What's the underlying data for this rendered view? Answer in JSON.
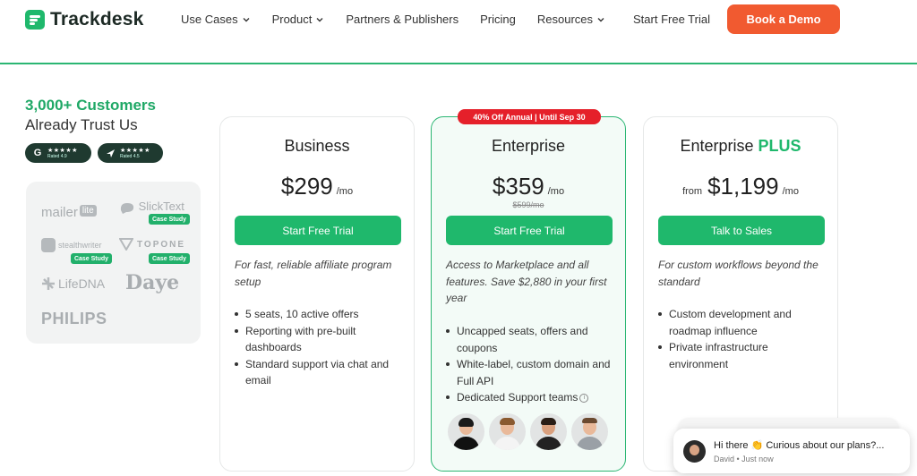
{
  "nav": {
    "logo_text": "Trackdesk",
    "links": [
      {
        "label": "Use Cases",
        "dropdown": true
      },
      {
        "label": "Product",
        "dropdown": true
      },
      {
        "label": "Partners & Publishers",
        "dropdown": false
      },
      {
        "label": "Pricing",
        "dropdown": false
      },
      {
        "label": "Resources",
        "dropdown": true
      }
    ],
    "trial_label": "Start Free Trial",
    "demo_label": "Book a Demo"
  },
  "trust": {
    "line1": "3,000+ Customers",
    "line2": "Already Trust Us",
    "badges": [
      {
        "icon": "g2-icon",
        "stars": "★★★★★",
        "rating": "Rated 4.9"
      },
      {
        "icon": "capterra-icon",
        "stars": "★★★★★",
        "rating": "Rated 4.5"
      }
    ]
  },
  "logos": {
    "mailerlite": "mailer",
    "mailerlite_tag": "lite",
    "slicktext": "SlickText",
    "stealthwriter": "stealthwriter",
    "topone": "TOPONE",
    "lifedna": "LifeDNA",
    "daye": "Daye",
    "philips": "PHILIPS",
    "case_study_label": "Case Study"
  },
  "promo": "40% Off Annual | Until Sep 30",
  "plans": [
    {
      "title": "Business",
      "title_suffix": "",
      "price_prefix": "",
      "price": "$299",
      "per": "/mo",
      "old_price": "",
      "cta": "Start Free Trial",
      "description": "For fast, reliable affiliate program setup",
      "features": [
        "5 seats, 10 active offers",
        "Reporting with pre-built dashboards",
        "Standard support via chat and email"
      ]
    },
    {
      "title": "Enterprise",
      "title_suffix": "",
      "price_prefix": "",
      "price": "$359",
      "per": "/mo",
      "old_price": "$599/mo",
      "cta": "Start Free Trial",
      "description": "Access to Marketplace and all features. Save $2,880 in your first year",
      "features": [
        "Uncapped seats, offers and coupons",
        "White-label, custom domain and Full API",
        "Dedicated Support teams"
      ]
    },
    {
      "title": "Enterprise",
      "title_suffix": "PLUS",
      "price_prefix": "from",
      "price": "$1,199",
      "per": "/mo",
      "old_price": "",
      "cta": "Talk to Sales",
      "description": "For custom workflows beyond the standard",
      "features": [
        "Custom development and roadmap influence",
        "Private infrastructure environment"
      ]
    }
  ],
  "chat": {
    "message": "Hi there 👏 Curious about our plans?...",
    "sender": "David",
    "time": "Just now"
  },
  "colors": {
    "brand_green": "#1fb86c",
    "demo_orange": "#f15a30",
    "promo_red": "#e5202a"
  }
}
